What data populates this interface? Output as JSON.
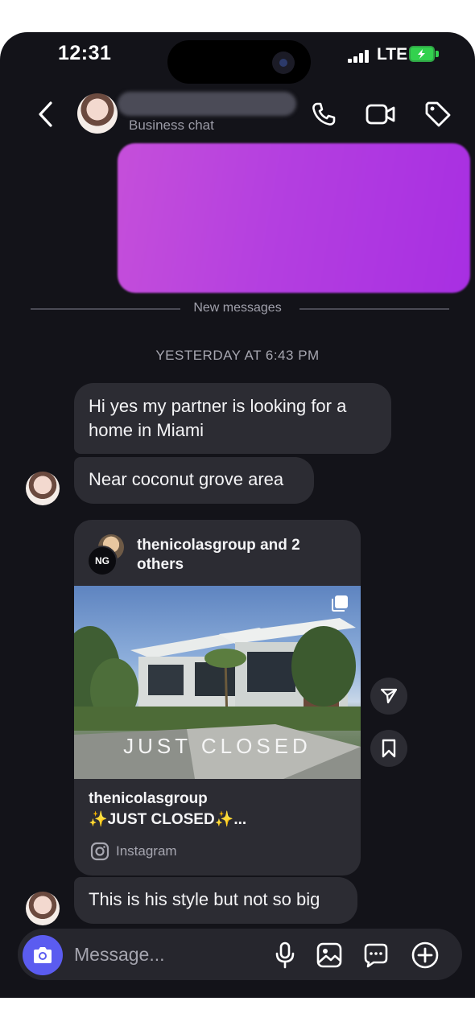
{
  "status_bar": {
    "time": "12:31",
    "network": "LTE"
  },
  "header": {
    "subtitle": "Business chat",
    "icons": [
      "back-chevron-icon",
      "phone-icon",
      "video-camera-icon",
      "tag-icon"
    ]
  },
  "thread": {
    "new_messages_label": "New messages",
    "date_separator": "YESTERDAY AT 6:43 PM",
    "messages": [
      {
        "text": "Hi yes my partner is looking for a home in Miami"
      },
      {
        "text": "Near coconut grove area"
      },
      {
        "text": "This is his style but not so big"
      }
    ],
    "shared_post": {
      "header": "thenicolasgroup and 2 others",
      "logo_text": "NG",
      "image_overlay_text": "JUST CLOSED",
      "username": "thenicolasgroup",
      "caption": "✨JUST CLOSED✨...",
      "source": "Instagram"
    }
  },
  "composer": {
    "placeholder": "Message...",
    "icons": [
      "camera-icon",
      "microphone-icon",
      "gallery-icon",
      "sticker-icon",
      "plus-icon"
    ]
  },
  "colors": {
    "background": "#131319",
    "bubble": "#2c2c33",
    "accent": "#5b5cf0",
    "battery": "#33d14e"
  }
}
